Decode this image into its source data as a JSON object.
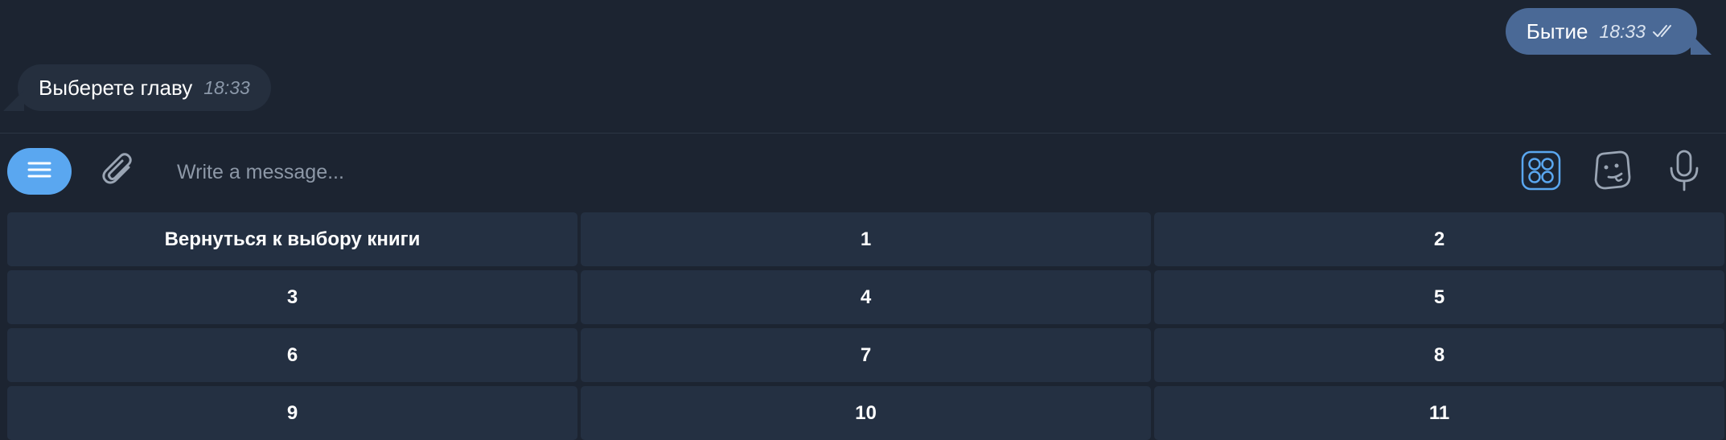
{
  "messages": [
    {
      "direction": "out",
      "text": "Бытие",
      "time": "18:33",
      "status": "read"
    },
    {
      "direction": "in",
      "text": "Выберете главу",
      "time": "18:33"
    }
  ],
  "composer": {
    "placeholder": "Write a message...",
    "icons": [
      "menu-icon",
      "paperclip-icon",
      "apps-grid-icon",
      "sticker-icon",
      "microphone-icon"
    ]
  },
  "keyboard": {
    "buttons": [
      "Вернуться к выбору книги",
      "1",
      "2",
      "3",
      "4",
      "5",
      "6",
      "7",
      "8",
      "9",
      "10",
      "11"
    ]
  },
  "colors": {
    "background": "#1c2431",
    "outgoing_bubble": "#4a6996",
    "incoming_bubble": "#252f3e",
    "accent": "#5aa7f0",
    "keyboard_button": "#243042"
  }
}
